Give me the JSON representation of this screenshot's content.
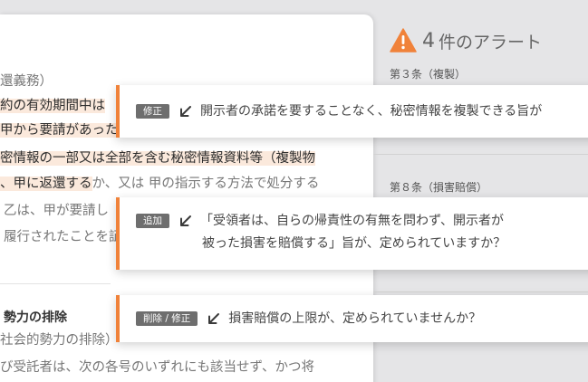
{
  "document": {
    "lines": [
      {
        "id": "l1",
        "parts": [
          {
            "text": "還義務）",
            "style": "faded"
          }
        ]
      },
      {
        "id": "l2",
        "parts": [
          {
            "text": "約の有効期間中は",
            "style": "hl"
          }
        ]
      },
      {
        "id": "l3",
        "parts": [
          {
            "text": "甲から要請があった",
            "style": "hl"
          }
        ]
      },
      {
        "id": "l4",
        "parts": [
          {
            "text": "密情報の一部又は全部を含む秘密情報資料等（複製物",
            "style": "hl"
          }
        ]
      },
      {
        "id": "l5",
        "parts": [
          {
            "text": "、甲に返還する",
            "style": "hl"
          },
          {
            "text": "か、又は 甲の指示する方法で処分する",
            "style": "faded"
          }
        ]
      },
      {
        "id": "l6",
        "parts": [
          {
            "text": "乙は、甲が要請し",
            "style": "faded"
          }
        ]
      },
      {
        "id": "l7",
        "parts": [
          {
            "text": "履行されたことを証",
            "style": "faded"
          }
        ]
      },
      {
        "id": "l8",
        "parts": [
          {
            "text": "勢力の排除",
            "style": "section"
          }
        ]
      },
      {
        "id": "l9",
        "parts": [
          {
            "text": "社会的勢力の排除）",
            "style": "faded"
          }
        ]
      },
      {
        "id": "l10",
        "parts": [
          {
            "text": "び受託者は、次の各号のいずれにも該当せず、かつ将",
            "style": "faded"
          }
        ]
      }
    ]
  },
  "alerts": {
    "count": "4",
    "suffix": "件のアラート",
    "icon": "warning-icon",
    "accent": "#f0823a",
    "articles": [
      {
        "label": "第３条（複製）"
      },
      {
        "label": "第８条（損害賠償）"
      }
    ],
    "cards": [
      {
        "tag": "修正",
        "lines": [
          "開示者の承諾を要することなく、秘密情報を複製できる旨が"
        ]
      },
      {
        "tag": "追加",
        "lines": [
          "「受領者は、自らの帰責性の有無を問わず、開示者が",
          "被った損害を賠償する」旨が、定められていますか？"
        ]
      },
      {
        "tag": "削除 / 修正",
        "lines": [
          "損害賠償の上限が、定められていませんか？"
        ]
      }
    ]
  }
}
